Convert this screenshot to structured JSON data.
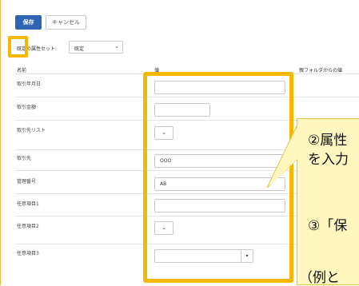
{
  "toolbar": {
    "save_label": "保存",
    "cancel_label": "キャンセル"
  },
  "attribute_set": {
    "label": "既定の属性セット:",
    "value": "既定"
  },
  "table": {
    "headers": {
      "name": "名前",
      "value": "値",
      "parent_value": "親フォルダからの値"
    },
    "rows": [
      {
        "label": "取引年月日",
        "value": ""
      },
      {
        "label": "取引金額",
        "value": ""
      },
      {
        "label": "取引先リスト",
        "value": ""
      },
      {
        "label": "取引先",
        "value": "OOO"
      },
      {
        "label": "管理番号",
        "value": "AB"
      },
      {
        "label": "任意項目1",
        "value": ""
      },
      {
        "label": "任意項目2",
        "value": ""
      },
      {
        "label": "任意項目3",
        "value": ""
      }
    ]
  },
  "callout": {
    "line1": "②属性",
    "line2": "を入力",
    "line3": "③「保",
    "line4": "（例と"
  },
  "colors": {
    "accent": "#2f64b4",
    "highlight": "#f5b800",
    "callout_bg": "#fff7bf"
  }
}
